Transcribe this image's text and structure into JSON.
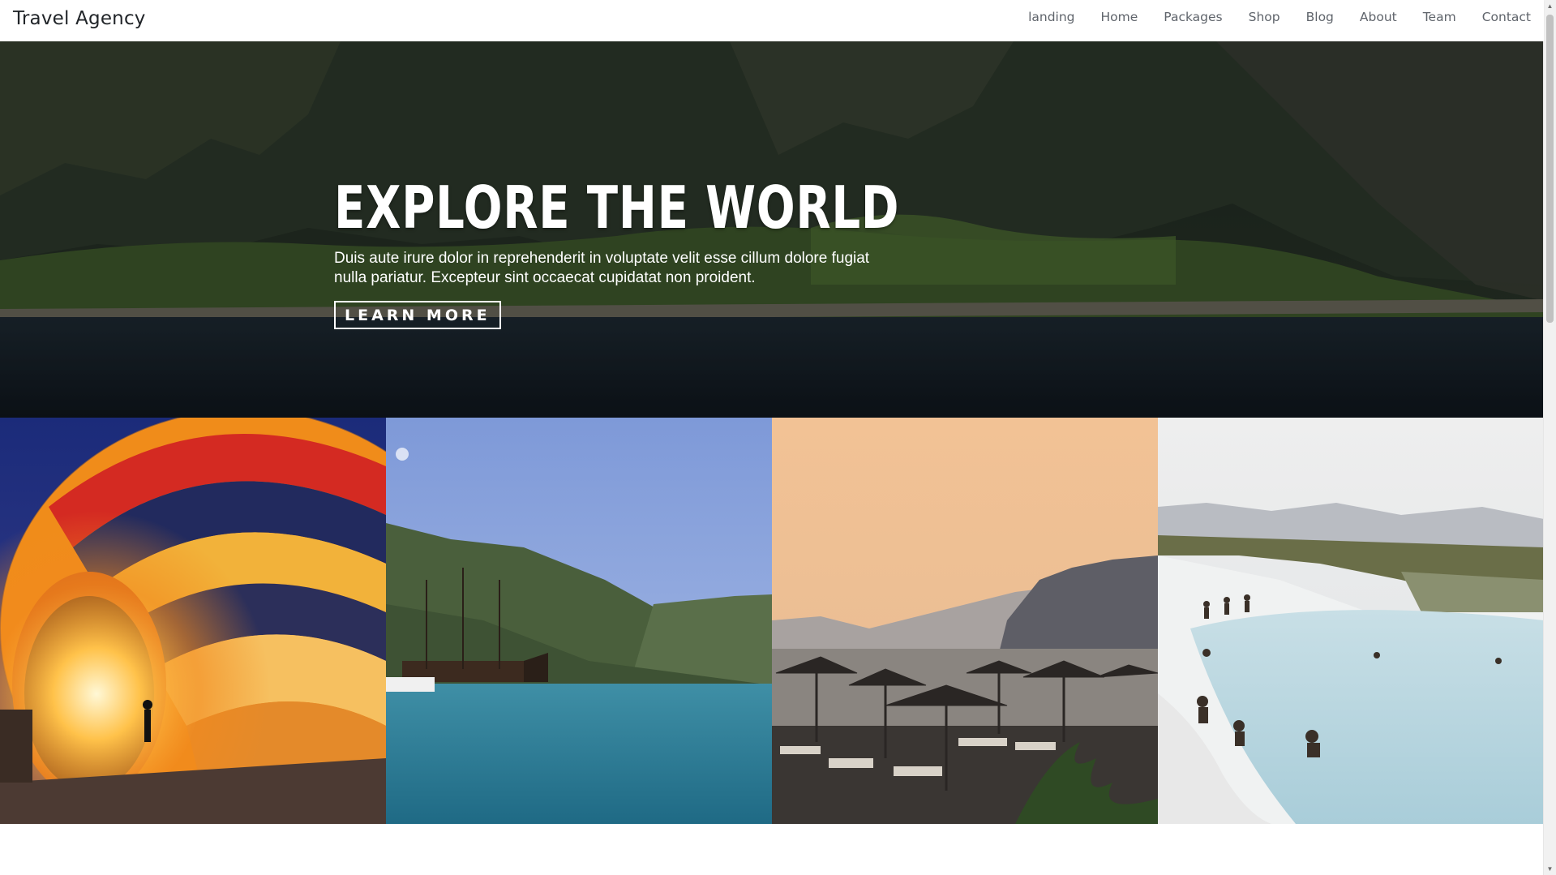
{
  "navbar": {
    "brand": "Travel Agency",
    "links": [
      "landing",
      "Home",
      "Packages",
      "Shop",
      "Blog",
      "About",
      "Team",
      "Contact"
    ]
  },
  "hero": {
    "title": "EXPLORE THE WORLD",
    "subtitle": "Duis aute irure dolor in reprehenderit in voluptate velit esse cillum dolore fugiat nulla pariatur. Excepteur sint occaecat cupidatat non proident.",
    "button_label": "LEARN MORE"
  },
  "gallery": {
    "images": [
      "hot-air-balloon",
      "harbor-with-sailing-ships",
      "beach-umbrellas-at-sunset",
      "thermal-pools"
    ]
  },
  "colors": {
    "brand_text": "#212529",
    "nav_text": "#5f646b",
    "hero_text": "#ffffff"
  }
}
